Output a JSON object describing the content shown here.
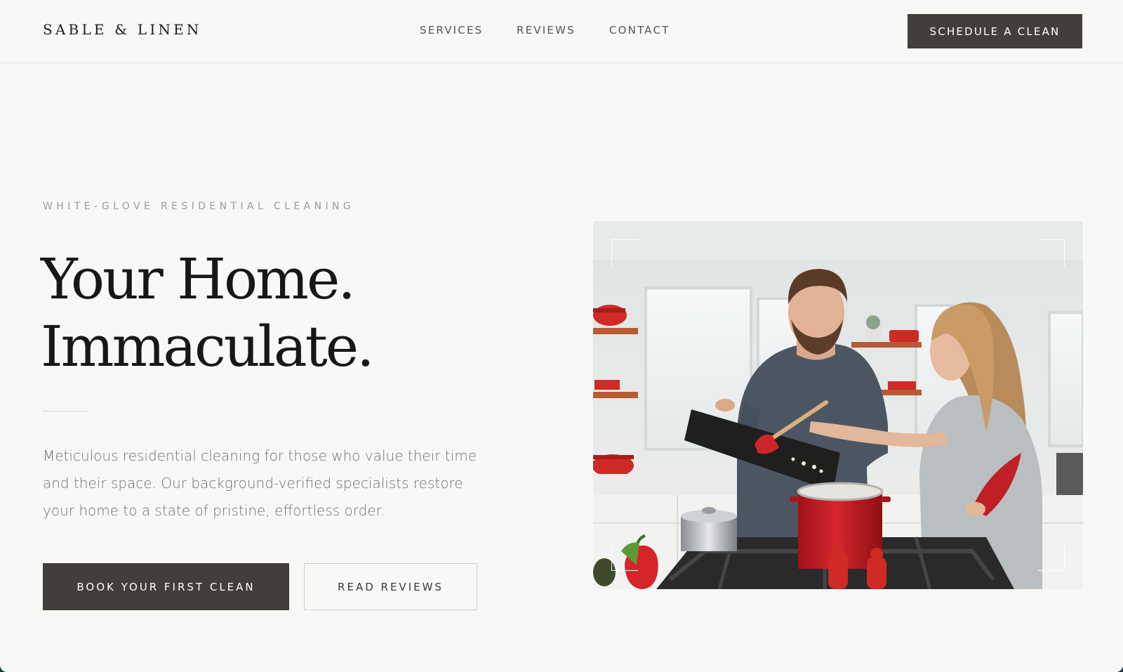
{
  "brand": {
    "logo": "SABLE & LINEN"
  },
  "nav": {
    "items": [
      {
        "label": "SERVICES"
      },
      {
        "label": "REVIEWS"
      },
      {
        "label": "CONTACT"
      }
    ],
    "cta_label": "SCHEDULE A CLEAN"
  },
  "hero": {
    "eyebrow": "WHITE-GLOVE RESIDENTIAL CLEANING",
    "headline_line1": "Your Home.",
    "headline_line2": "Immaculate.",
    "intro": "Meticulous residential cleaning for those who value their time and their space. Our background-verified specialists restore your home to a state of pristine, effortless order.",
    "primary_button": "BOOK YOUR FIRST CLEAN",
    "secondary_button": "READ REVIEWS",
    "image": "photo: couple cooking together in a bright kitchen with red cookware"
  },
  "colors": {
    "page_background": "#f8f8f7",
    "button_dark": "#423e3b",
    "heading_text": "#171717",
    "body_text": "#6f6f6d",
    "accent_red": "#c8202a",
    "frame_background": "#1f3a40"
  }
}
